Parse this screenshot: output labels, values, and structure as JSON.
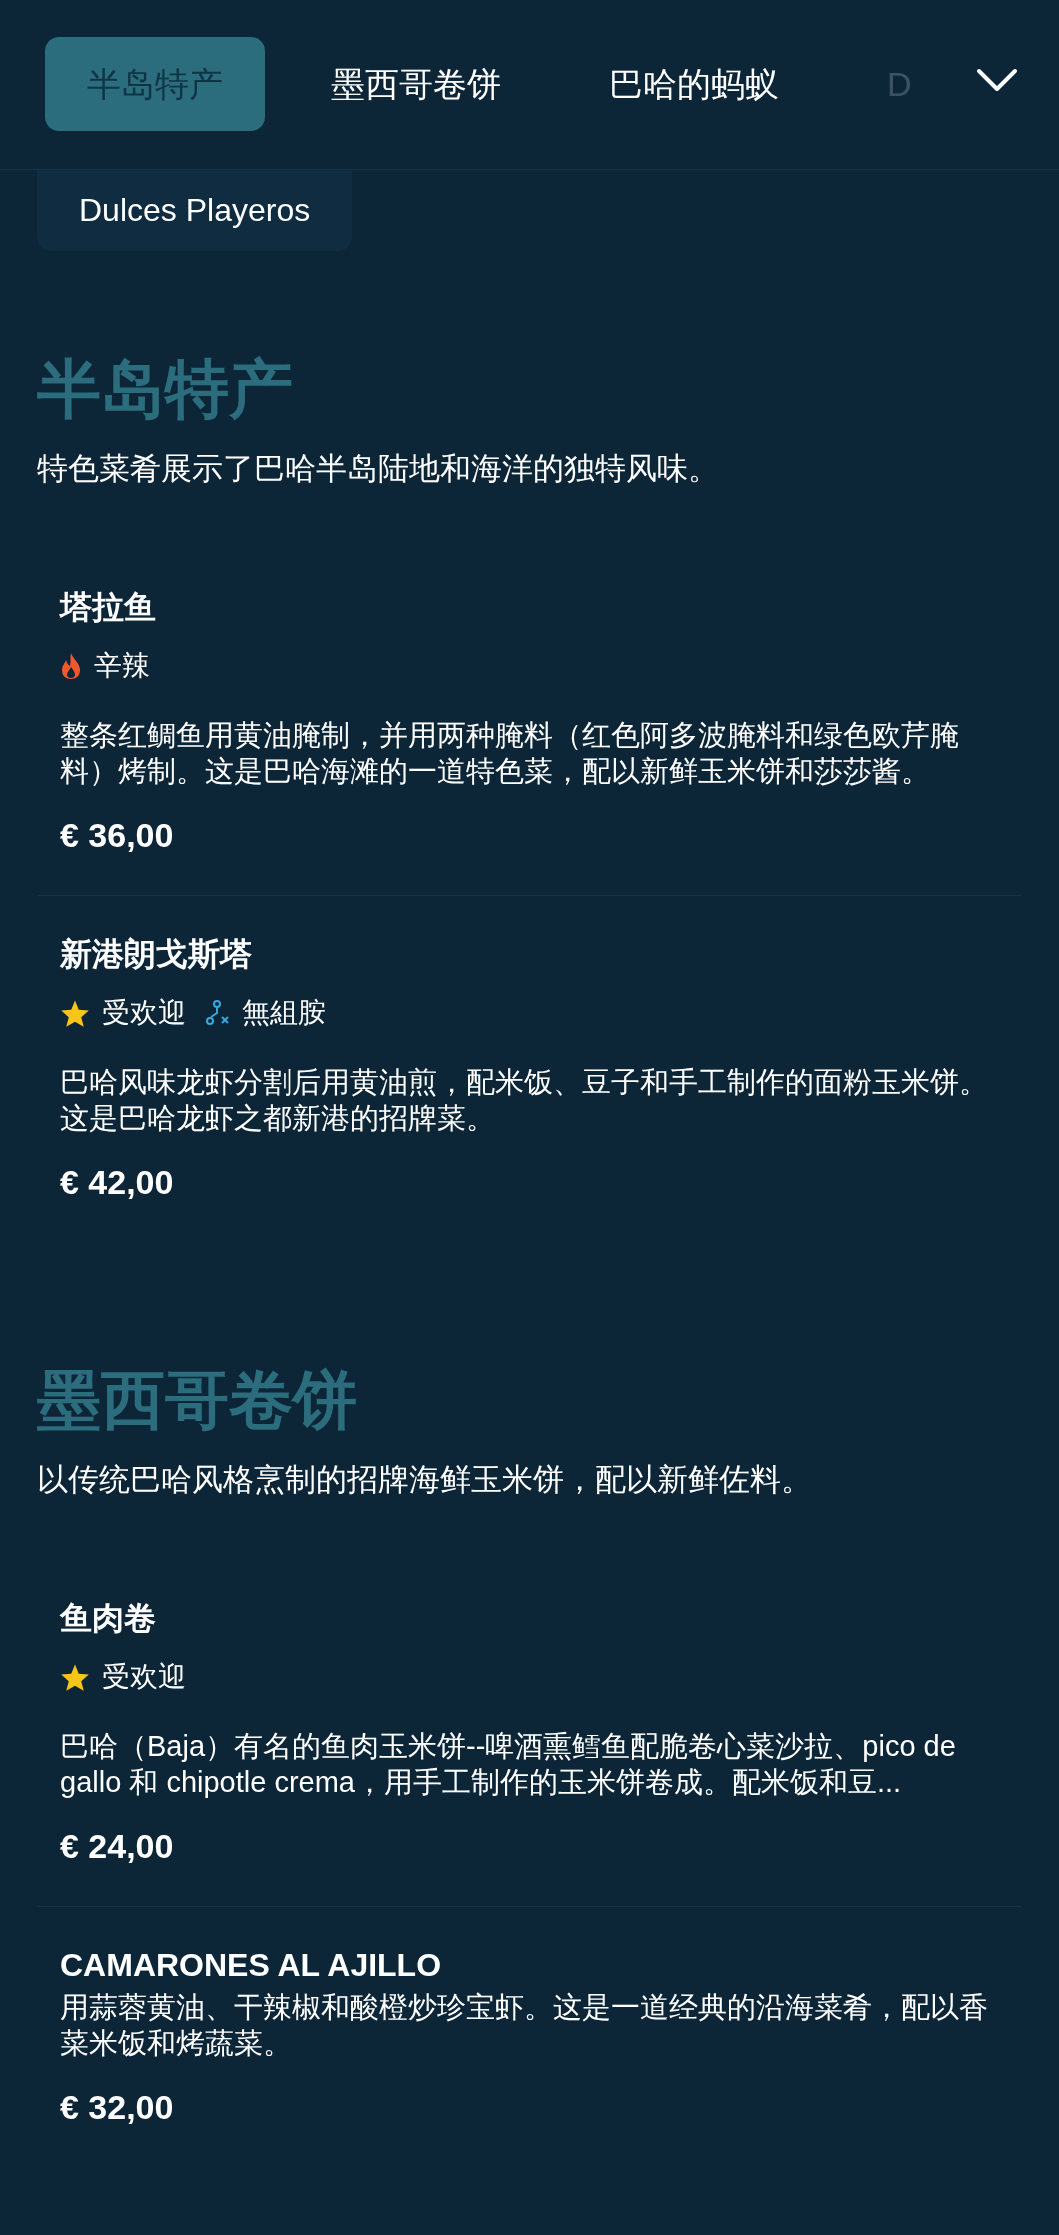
{
  "tabs": [
    {
      "label": "半岛特产",
      "selected": true,
      "faded": false
    },
    {
      "label": "墨西哥卷饼",
      "selected": false,
      "faded": false
    },
    {
      "label": "巴哈的蚂蚁",
      "selected": false,
      "faded": false
    },
    {
      "label": "D",
      "selected": false,
      "faded": true
    }
  ],
  "subtabs": [
    {
      "label": "Dulces Playeros",
      "selected": false
    }
  ],
  "sections": [
    {
      "title": "半岛特产",
      "description": "特色菜肴展示了巴哈半岛陆地和海洋的独特风味。",
      "items": [
        {
          "name": "塔拉鱼",
          "tags": [
            {
              "kind": "spicy",
              "label": "辛辣"
            }
          ],
          "description": "整条红鲷鱼用黄油腌制，并用两种腌料（红色阿多波腌料和绿色欧芹腌料）烤制。这是巴哈海滩的一道特色菜，配以新鲜玉米饼和莎莎酱。",
          "price": "€ 36,00"
        },
        {
          "name": "新港朗戈斯塔",
          "tags": [
            {
              "kind": "popular",
              "label": "受欢迎"
            },
            {
              "kind": "histamine_free",
              "label": "無組胺"
            }
          ],
          "description": "巴哈风味龙虾分割后用黄油煎，配米饭、豆子和手工制作的面粉玉米饼。这是巴哈龙虾之都新港的招牌菜。",
          "price": "€ 42,00"
        }
      ]
    },
    {
      "title": "墨西哥卷饼",
      "description": "以传统巴哈风格烹制的招牌海鲜玉米饼，配以新鲜佐料。",
      "items": [
        {
          "name": "鱼肉卷",
          "tags": [
            {
              "kind": "popular",
              "label": "受欢迎"
            }
          ],
          "description": "巴哈（Baja）有名的鱼肉玉米饼--啤酒熏鳕鱼配脆卷心菜沙拉、pico de gallo 和 chipotle crema，用手工制作的玉米饼卷成。配米饭和豆...",
          "price": "€ 24,00"
        },
        {
          "name": "CAMARONES AL AJILLO",
          "description": "用蒜蓉黄油、干辣椒和酸橙炒珍宝虾。这是一道经典的沿海菜肴，配以香菜米饭和烤蔬菜。",
          "price": "€ 32,00"
        }
      ]
    }
  ]
}
